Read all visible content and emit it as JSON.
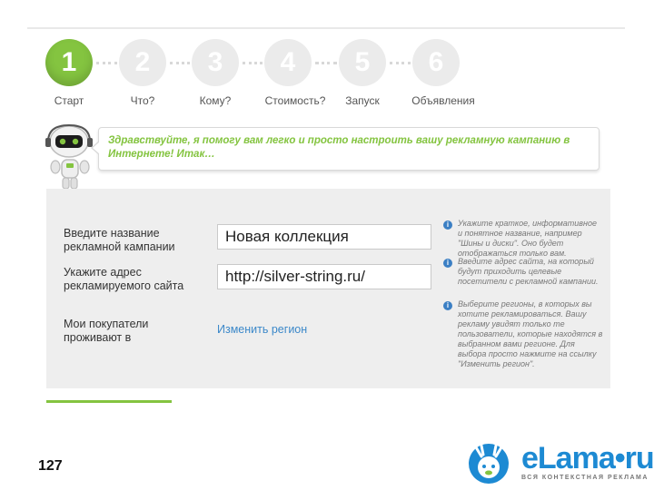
{
  "wizard": {
    "steps": [
      {
        "number": "1",
        "label": "Старт",
        "active": true
      },
      {
        "number": "2",
        "label": "Что?",
        "active": false
      },
      {
        "number": "3",
        "label": "Кому?",
        "active": false
      },
      {
        "number": "4",
        "label": "Стоимость?",
        "active": false
      },
      {
        "number": "5",
        "label": "Запуск",
        "active": false
      },
      {
        "number": "6",
        "label": "Объявления",
        "active": false
      }
    ],
    "active_color": "#84c440",
    "inactive_color": "#ebebeb"
  },
  "assistant": {
    "icon": "robot-icon",
    "message": "Здравствуйте, я помогу вам легко и просто настроить вашу рекламную кампанию в Интернете! Итак…"
  },
  "form": {
    "campaign_name": {
      "label": "Введите название рекламной кампании",
      "value": "Новая коллекция",
      "hint": "Укажите краткое, информативное и понятное название, например \"Шины и диски\". Оно будет отображаться только вам."
    },
    "site_url": {
      "label": "Укажите адрес рекламируемого сайта",
      "value": "http://silver-string.ru/",
      "hint": "Введите адрес сайта, на который будут приходить целевые посетители с рекламной кампании."
    },
    "region": {
      "label": "Мои покупатели проживают в",
      "link": "Изменить регион",
      "hint": "Выберите регионы, в которых вы хотите рекламироваться. Вашу рекламу увидят только те пользователи, которые находятся в выбранном вами регионе. Для выбора просто нажмите на ссылку \"Изменить регион\"."
    },
    "info_icon": "info-icon"
  },
  "page_number": "127",
  "logo": {
    "icon": "elama-deer-icon",
    "text": "eLama•ru",
    "tagline": "ВСЯ КОНТЕКСТНАЯ РЕКЛАМА",
    "color": "#1d8ad3"
  }
}
